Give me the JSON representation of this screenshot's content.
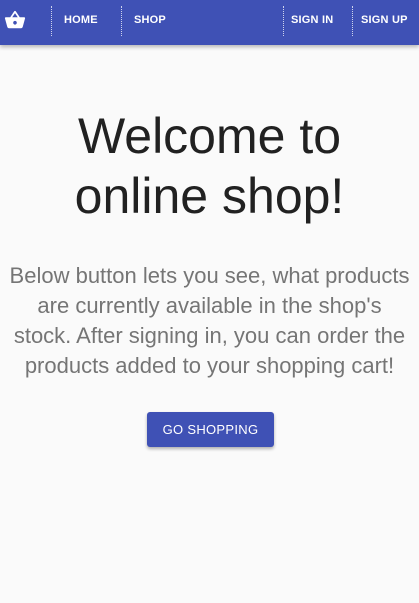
{
  "toolbar": {
    "logo_icon": "shopping-basket-icon",
    "home_label": "HOME",
    "shop_label": "SHOP",
    "signin_label": "SIGN IN",
    "signup_label": "SIGN UP",
    "background_color": "#3f51b5",
    "text_color": "#ffffff"
  },
  "main": {
    "headline_line1": "Welcome to",
    "headline_line2": "online shop!",
    "description_line1": "Below button lets you see, what products",
    "description_line2": "are currently available in the shop's",
    "description_line3": "stock. After signing in, you can order the",
    "description_line4": "products added to your shopping cart!",
    "cta_label": "GO SHOPPING",
    "cta_color": "#3f51b5"
  }
}
